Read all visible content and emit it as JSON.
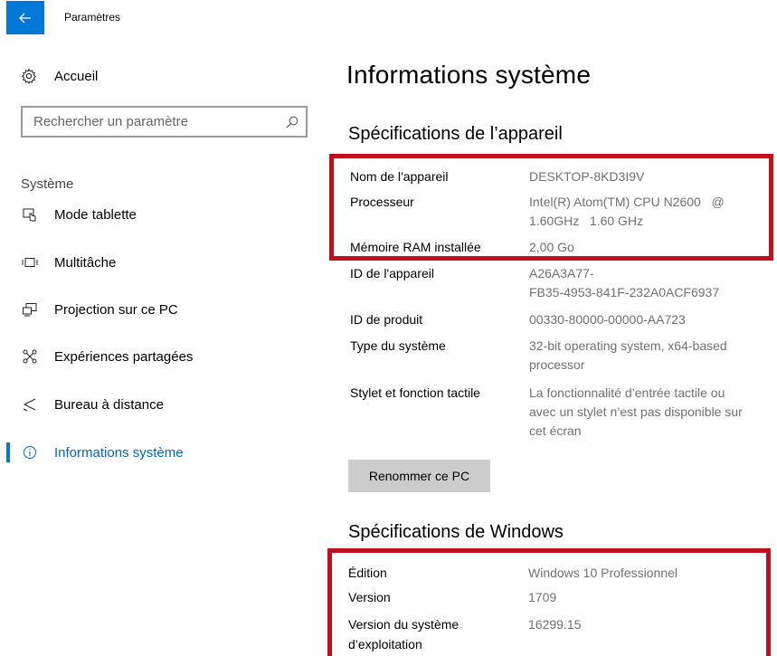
{
  "window": {
    "title": "Paramètres"
  },
  "sidebar": {
    "home_label": "Accueil",
    "search_placeholder": "Rechercher un paramètre",
    "section_label": "Système",
    "items": [
      {
        "label": "Mode tablette",
        "icon": "tablet-mode-icon"
      },
      {
        "label": "Multitâche",
        "icon": "multitask-icon"
      },
      {
        "label": "Projection sur ce PC",
        "icon": "projection-icon"
      },
      {
        "label": "Expériences partagées",
        "icon": "shared-experiences-icon"
      },
      {
        "label": "Bureau à distance",
        "icon": "remote-desktop-icon"
      },
      {
        "label": "Informations système",
        "icon": "info-icon",
        "active": true
      }
    ]
  },
  "main": {
    "title": "Informations système",
    "device_section": {
      "title": "Spécifications de l’appareil",
      "specs": [
        {
          "label": "Nom de l'appareil",
          "value_lines": [
            "DESKTOP-8KD3I9V"
          ]
        },
        {
          "label": "Processeur",
          "value_lines": [
            "Intel(R) Atom(TM) CPU N2600   @",
            "1.60GHz   1.60 GHz"
          ]
        },
        {
          "label": "Mémoire RAM installée",
          "value_lines": [
            "2,00 Go"
          ]
        },
        {
          "label": "ID de l'appareil",
          "value_lines": [
            "A26A3A77-",
            "FB35-4953-841F-232A0ACF6937"
          ]
        },
        {
          "label": "ID de produit",
          "value_lines": [
            "00330-80000-00000-AA723"
          ]
        },
        {
          "label": "Type du système",
          "value_lines": [
            "32-bit operating system, x64-based",
            "processor"
          ]
        },
        {
          "label": "Stylet et fonction tactile",
          "value_lines": [
            "La fonctionnalité d’entrée tactile ou",
            "avec un stylet n’est pas disponible sur",
            "cet écran"
          ]
        }
      ]
    },
    "rename_button": "Renommer ce PC",
    "windows_section": {
      "title": "Spécifications de Windows",
      "specs": [
        {
          "label_lines": [
            "Édition"
          ],
          "value": "Windows 10 Professionnel"
        },
        {
          "label_lines": [
            "Version"
          ],
          "value": "1709"
        },
        {
          "label_lines": [
            "Version du système",
            "d’exploitation"
          ],
          "value": "16299.15"
        }
      ]
    }
  },
  "colors": {
    "accent": "#0078d7",
    "highlight_border": "#c0101c",
    "value_text": "#707070"
  }
}
